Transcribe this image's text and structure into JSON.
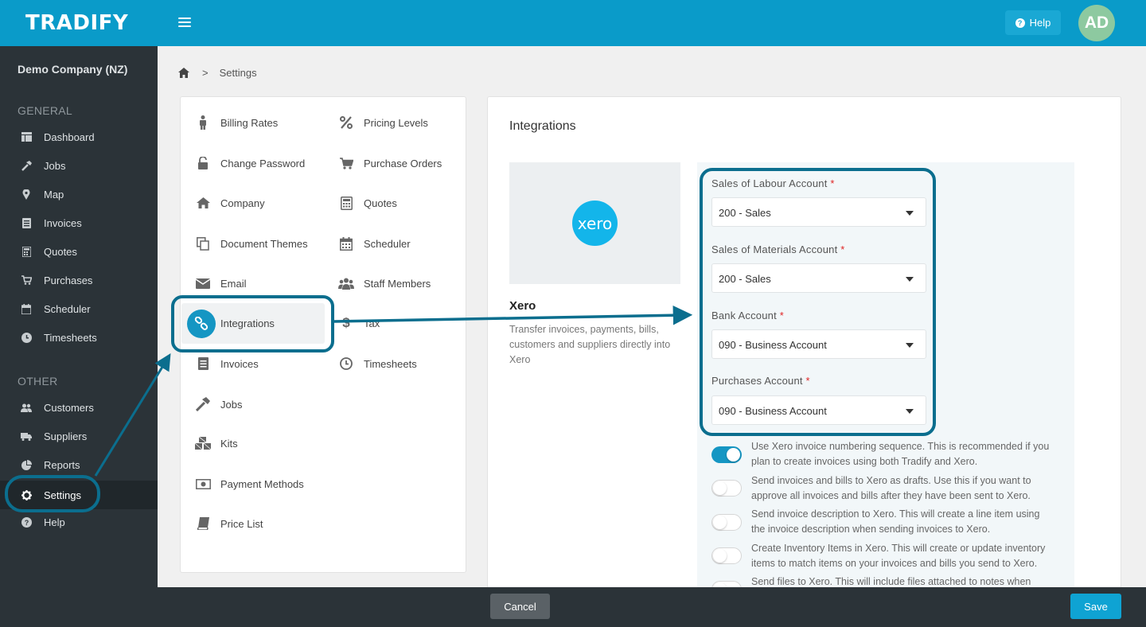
{
  "app": {
    "logo": "TRADIFY"
  },
  "header": {
    "help_label": "Help",
    "avatar_initials": "AD"
  },
  "sidebar": {
    "company": "Demo Company (NZ)",
    "general_title": "GENERAL",
    "other_title": "OTHER",
    "general_items": [
      {
        "label": "Dashboard",
        "icon": "dashboard-icon"
      },
      {
        "label": "Jobs",
        "icon": "hammer-icon"
      },
      {
        "label": "Map",
        "icon": "map-pin-icon"
      },
      {
        "label": "Invoices",
        "icon": "invoice-icon"
      },
      {
        "label": "Quotes",
        "icon": "calculator-icon"
      },
      {
        "label": "Purchases",
        "icon": "cart-icon"
      },
      {
        "label": "Scheduler",
        "icon": "calendar-icon"
      },
      {
        "label": "Timesheets",
        "icon": "clock-icon"
      }
    ],
    "other_items": [
      {
        "label": "Customers",
        "icon": "users-icon"
      },
      {
        "label": "Suppliers",
        "icon": "truck-icon"
      },
      {
        "label": "Reports",
        "icon": "pie-chart-icon"
      },
      {
        "label": "Settings",
        "icon": "gear-icon",
        "active": true
      },
      {
        "label": "Help",
        "icon": "question-icon"
      }
    ]
  },
  "breadcrumb": {
    "current": "Settings",
    "separator": ">"
  },
  "settings_menu": {
    "left": [
      {
        "label": "Billing Rates",
        "icon": "person-icon"
      },
      {
        "label": "Change Password",
        "icon": "unlock-icon"
      },
      {
        "label": "Company",
        "icon": "home-icon"
      },
      {
        "label": "Document Themes",
        "icon": "copy-icon"
      },
      {
        "label": "Email",
        "icon": "envelope-icon"
      },
      {
        "label": "Integrations",
        "icon": "link-icon",
        "active": true
      },
      {
        "label": "Invoices",
        "icon": "invoice-icon"
      },
      {
        "label": "Jobs",
        "icon": "hammer-icon"
      },
      {
        "label": "Kits",
        "icon": "cubes-icon"
      },
      {
        "label": "Payment Methods",
        "icon": "money-icon"
      },
      {
        "label": "Price List",
        "icon": "book-icon"
      }
    ],
    "right": [
      {
        "label": "Pricing Levels",
        "icon": "percent-icon"
      },
      {
        "label": "Purchase Orders",
        "icon": "cart-icon"
      },
      {
        "label": "Quotes",
        "icon": "calculator-icon"
      },
      {
        "label": "Scheduler",
        "icon": "calendar-icon"
      },
      {
        "label": "Staff Members",
        "icon": "users-icon"
      },
      {
        "label": "Tax",
        "icon": "dollar-icon"
      },
      {
        "label": "Timesheets",
        "icon": "clock-icon"
      }
    ]
  },
  "integrations": {
    "title": "Integrations",
    "xero_logo_text": "xero",
    "xero_name": "Xero",
    "xero_description": "Transfer invoices, payments, bills, customers and suppliers directly into Xero",
    "fields": [
      {
        "label": "Sales of Labour Account",
        "value": "200 - Sales"
      },
      {
        "label": "Sales of Materials Account",
        "value": "200 - Sales"
      },
      {
        "label": "Bank Account",
        "value": "090 - Business Account"
      },
      {
        "label": "Purchases Account",
        "value": "090 - Business Account"
      }
    ],
    "required_mark": "*",
    "toggles": [
      {
        "text": "Use Xero invoice numbering sequence. This is recommended if you plan to create invoices using both Tradify and Xero.",
        "on": true
      },
      {
        "text": "Send invoices and bills to Xero as drafts. Use this if you want to approve all invoices and bills after they have been sent to Xero.",
        "on": false
      },
      {
        "text": "Send invoice description to Xero. This will create a line item using the invoice description when sending invoices to Xero.",
        "on": false
      },
      {
        "text": "Create Inventory Items in Xero. This will create or update inventory items to match items on your invoices and bills you send to Xero.",
        "on": false
      },
      {
        "text": "Send files to Xero. This will include files attached to notes when",
        "on": false
      }
    ]
  },
  "footer": {
    "cancel_label": "Cancel",
    "save_label": "Save"
  },
  "colors": {
    "brand": "#0a9bc9",
    "sidebar": "#2b3338",
    "annotation": "#0b6e8e",
    "toggle_on": "#1596c3"
  }
}
